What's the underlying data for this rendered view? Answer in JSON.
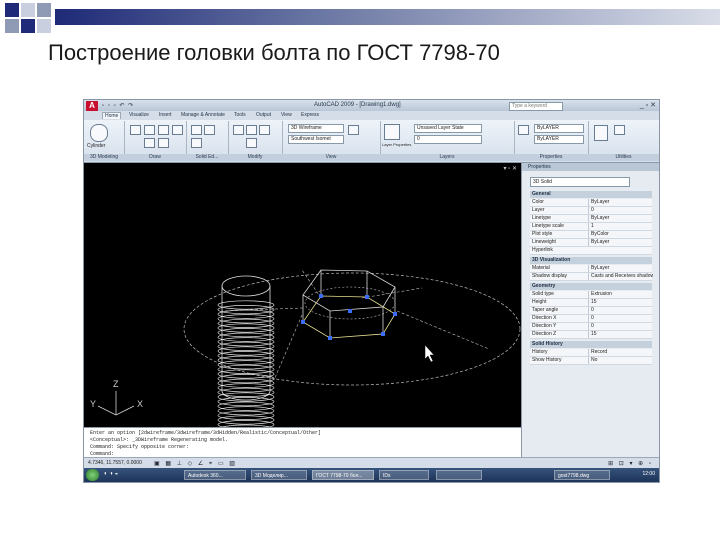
{
  "slide": {
    "title": "Построение головки болта по ГОСТ 7798-70"
  },
  "colors": {
    "bullet_square_dark": "#1f2a78",
    "bullet_square_mid": "#8f9bb4",
    "bullet_square_light": "#c9cfdf",
    "model_wire": "#dcdcdc",
    "model_grip": "#3a6cf5",
    "model_edge": "#e7e090"
  },
  "app": {
    "title": "AutoCAD 2009 - [Drawing1.dwg]",
    "search_placeholder": "Type a keyword",
    "tabs": [
      "Home",
      "Visualize",
      "Insert",
      "Manage & Annotate",
      "Tools",
      "Output",
      "View",
      "Express"
    ],
    "ribbon": {
      "panels": [
        "3D Modeling",
        "Draw",
        "Solid Ed...",
        "Modify",
        "View",
        "Layers",
        "Properties",
        "Utilities"
      ],
      "view_style": "3D Wireframe",
      "view_direction": "Southwest Isomet",
      "layer_state": "Unsaved Layer State",
      "layer_current": "0",
      "color_byLayer": "ByLAYER",
      "linetype_byLayer": "ByLAYER",
      "layer_props_label": "Layer Properties",
      "cylinder_label": "Cylinder"
    },
    "viewport": {
      "ucs_labels": [
        "Z",
        "Y",
        "X"
      ]
    },
    "properties": {
      "header": "Properties",
      "selected_type": "3D Solid",
      "sections": [
        {
          "name": "General",
          "rows": [
            {
              "k": "Color",
              "v": "ByLayer"
            },
            {
              "k": "Layer",
              "v": "0"
            },
            {
              "k": "Linetype",
              "v": "ByLayer"
            },
            {
              "k": "Linetype scale",
              "v": "1"
            },
            {
              "k": "Plot style",
              "v": "ByColor"
            },
            {
              "k": "Lineweight",
              "v": "ByLayer"
            },
            {
              "k": "Hyperlink",
              "v": ""
            }
          ]
        },
        {
          "name": "3D Visualization",
          "rows": [
            {
              "k": "Material",
              "v": "ByLayer"
            },
            {
              "k": "Shadow display",
              "v": "Casts and Receives shadows"
            }
          ]
        },
        {
          "name": "Geometry",
          "rows": [
            {
              "k": "Solid type",
              "v": "Extrusion"
            },
            {
              "k": "Height",
              "v": "15"
            },
            {
              "k": "Taper angle",
              "v": "0"
            },
            {
              "k": "Direction X",
              "v": "0"
            },
            {
              "k": "Direction Y",
              "v": "0"
            },
            {
              "k": "Direction Z",
              "v": "15"
            }
          ]
        },
        {
          "name": "Solid History",
          "rows": [
            {
              "k": "History",
              "v": "Record"
            },
            {
              "k": "Show History",
              "v": "No"
            }
          ]
        }
      ]
    },
    "command_lines": [
      "Enter an option [2dwireframe/3dwireframe/3dHidden/Realistic/Conceptual/Other]",
      "<Conceptual>: _3DWireframe Regenerating model.",
      "Command: Specify opposite corner:",
      "Command:"
    ],
    "status_coords": "4.7346, 11.7557, 0.0000",
    "taskbar": {
      "items": [
        "Autodesk 360...",
        "3D Моделир...",
        "ГОСТ 7798-70 бол...",
        "IDs",
        "",
        "gost7798.dwg"
      ],
      "clock": "12:00"
    }
  }
}
